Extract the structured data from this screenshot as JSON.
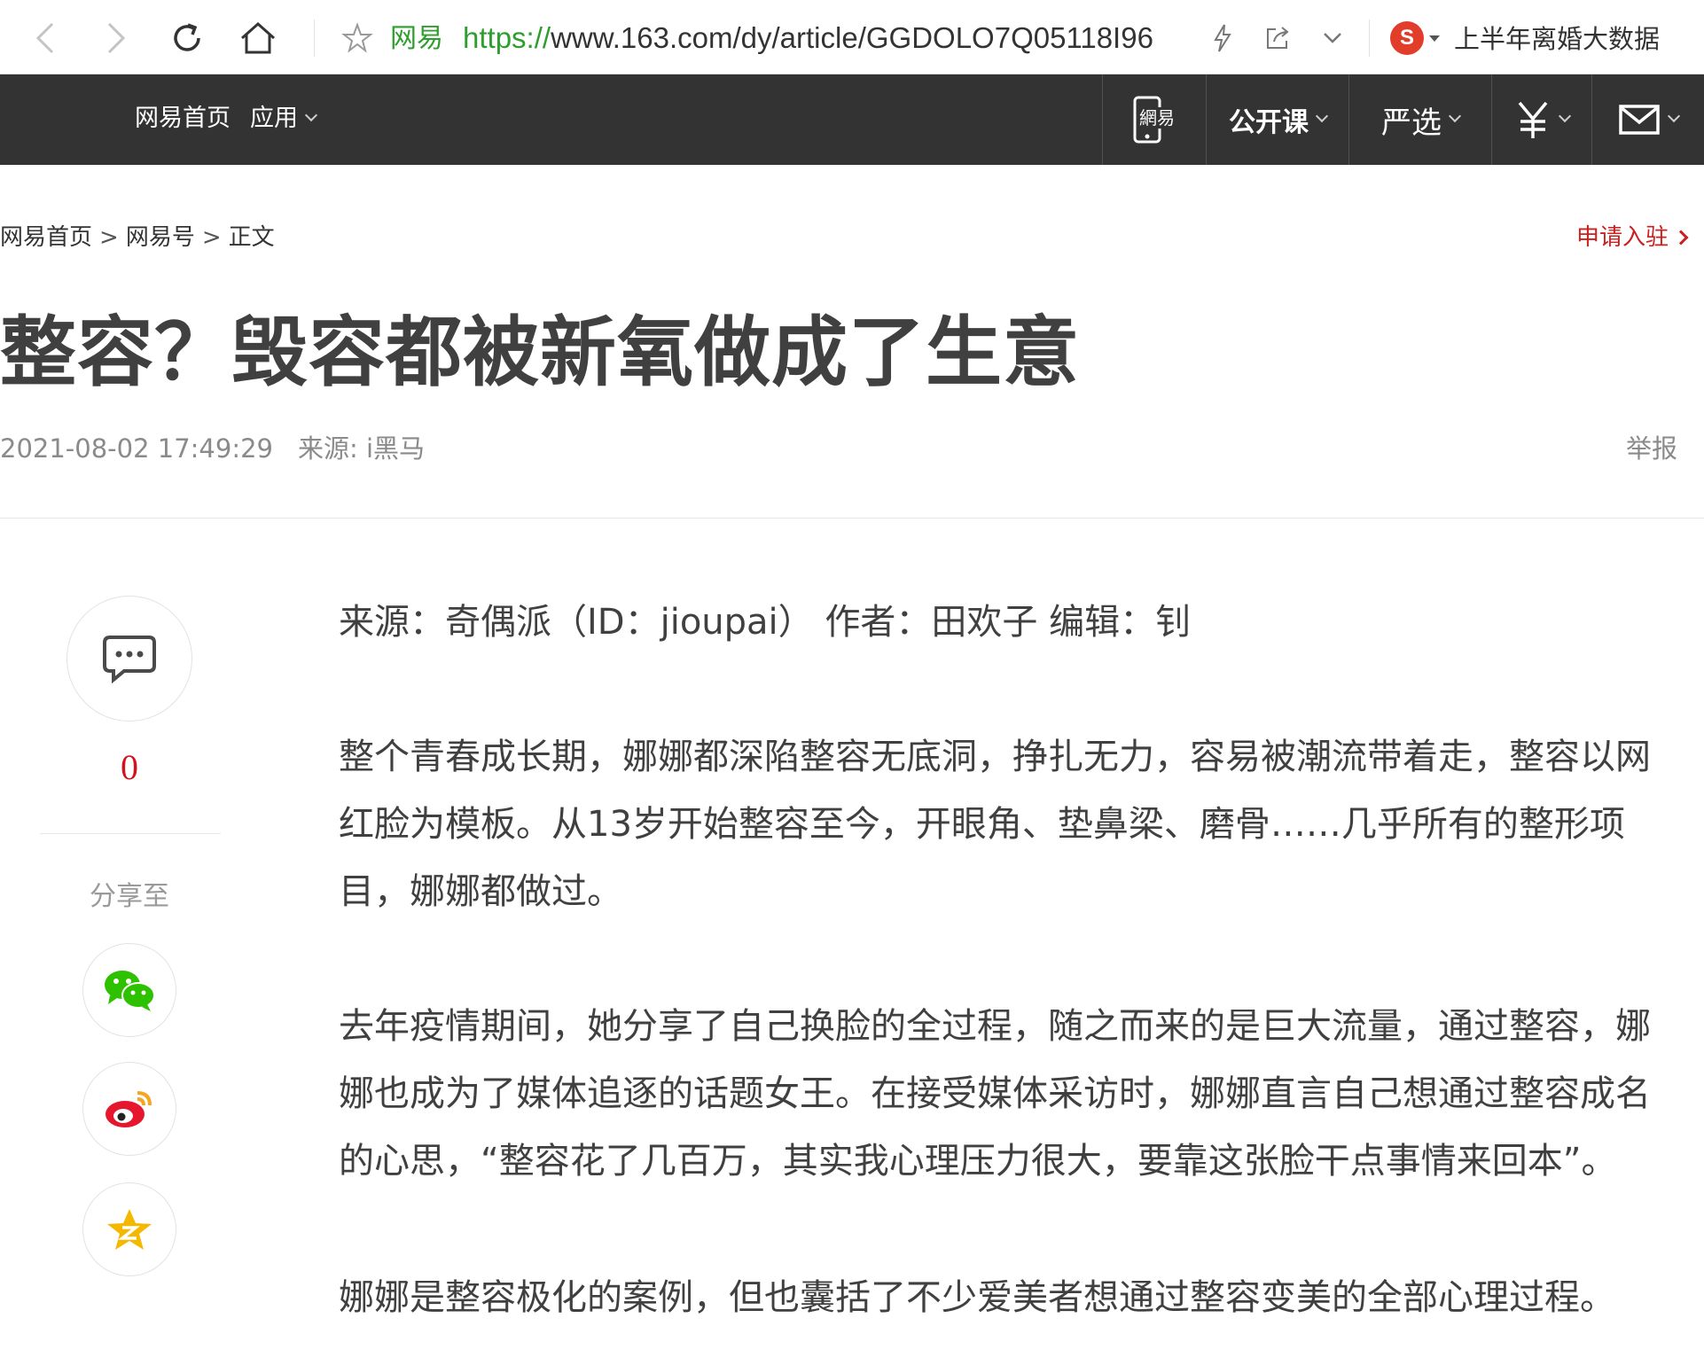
{
  "browser": {
    "site_name": "网易",
    "url_protocol": "https://",
    "url_rest": "www.163.com/dy/article/GGDOLO7Q05118I96",
    "search_logo": "S",
    "search_text": "上半年离婚大数据"
  },
  "nav": {
    "home": "网易首页",
    "apps": "应用",
    "open_course": "公开课",
    "yanxuan": "严选",
    "mobile_icon": "phone-icon",
    "money_icon": "yen-icon",
    "mail_icon": "mail-icon"
  },
  "breadcrumb": {
    "home": "网易首页",
    "sep1": ">",
    "section": "网易号",
    "sep2": ">",
    "current": "正文"
  },
  "apply_link": "申请入驻",
  "article": {
    "title": "整容？毁容都被新氧做成了生意",
    "datetime": "2021-08-02 17:49:29",
    "source": "来源: i黑马",
    "report": "举报",
    "source_line": "来源：奇偶派（ID：jioupai） 作者：田欢子 编辑：钊",
    "paragraphs": [
      "整个青春成长期，娜娜都深陷整容无底洞，挣扎无力，容易被潮流带着走，整容以网红脸为模板。从13岁开始整容至今，开眼角、垫鼻梁、磨骨……几乎所有的整形项目，娜娜都做过。",
      "去年疫情期间，她分享了自己换脸的全过程，随之而来的是巨大流量，通过整容，娜娜也成为了媒体追逐的话题女王。在接受媒体采访时，娜娜直言自己想通过整容成名的心思，“整容花了几百万，其实我心理压力很大，要靠这张脸干点事情来回本”。",
      "娜娜是整容极化的案例，但也囊括了不少爱美者想通过整容变美的全部心理过程。"
    ]
  },
  "rail": {
    "comment_count": "0",
    "share_label": "分享至"
  },
  "colors": {
    "nav_bg": "#333333",
    "accent_red": "#d0131e",
    "url_green": "#2e9f2e",
    "wechat_green": "#2dc100",
    "weibo_red": "#e6162d",
    "qzone_yellow": "#f5b800"
  }
}
